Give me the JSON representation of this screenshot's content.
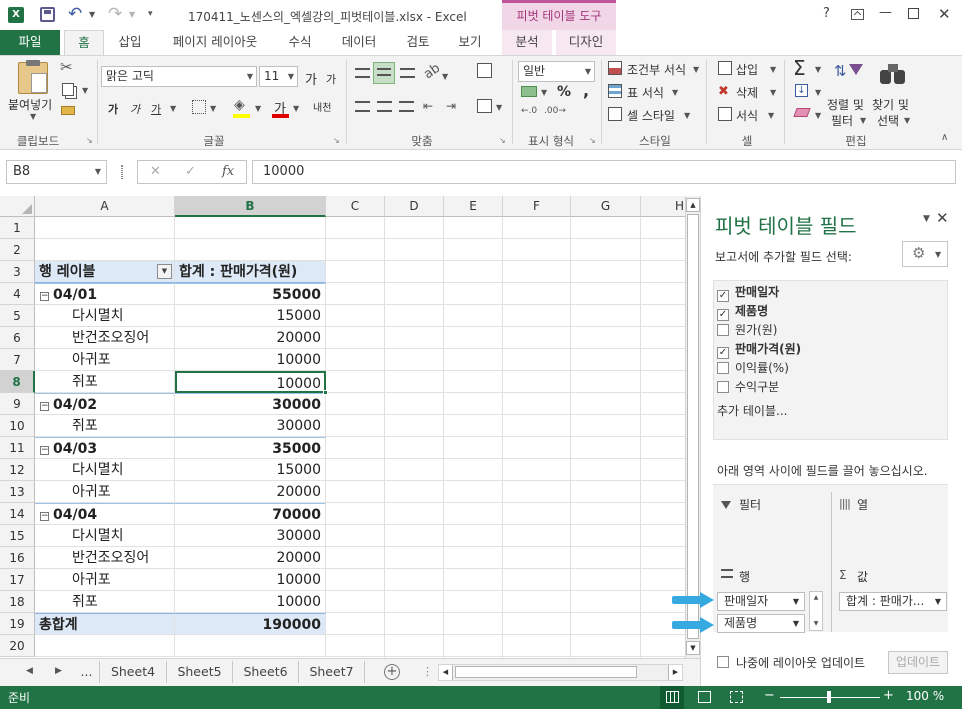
{
  "title": {
    "filename": "170411_노센스의_엑셀강의_피벗테이블.xlsx - Excel",
    "context_tab": "피벗 테이블 도구",
    "help": "?",
    "minimize": "—",
    "close": "✕"
  },
  "tabs": {
    "file": "파일",
    "home": "홈",
    "insert": "삽입",
    "page_layout": "페이지 레이아웃",
    "formulas": "수식",
    "data": "데이터",
    "review": "검토",
    "view": "보기",
    "analyze": "분석",
    "design": "디자인"
  },
  "ribbon": {
    "paste": "붙여넣기",
    "clipboard": "클립보드",
    "font_name": "맑은 고딕",
    "font_size": "11",
    "bold": "가",
    "italic": "가",
    "underline": "가",
    "font_color": "가",
    "grow_font": "가",
    "shrink_font": "가",
    "phonetic": "내천",
    "font_group": "글꼴",
    "align_group": "맞춤",
    "number_format": "일반",
    "percent": "%",
    "comma": ",",
    "number_group": "표시 형식",
    "cond_format": "조건부 서식",
    "table_format": "표 서식",
    "cell_style": "셀 스타일",
    "style_group": "스타일",
    "insert": "삽입",
    "delete": "삭제",
    "format": "서식",
    "cells_group": "셀",
    "sort_filter_1": "정렬 및",
    "sort_filter_2": "필터",
    "find_select_1": "찾기 및",
    "find_select_2": "선택",
    "editing_group": "편집",
    "sigma": "Σ"
  },
  "formula_bar": {
    "name_box": "B8",
    "cancel": "✕",
    "enter": "✓",
    "fx": "fx",
    "value": "10000"
  },
  "columns": [
    "A",
    "B",
    "C",
    "D",
    "E",
    "F",
    "G",
    "H"
  ],
  "rows": [
    {
      "n": "1",
      "a": "",
      "b": ""
    },
    {
      "n": "2",
      "a": "",
      "b": ""
    },
    {
      "n": "3",
      "a": "행 레이블",
      "b": "합계 : 판매가격(원)"
    },
    {
      "n": "4",
      "a": "04/01",
      "b": "55000"
    },
    {
      "n": "5",
      "a": "다시멸치",
      "b": "15000"
    },
    {
      "n": "6",
      "a": "반건조오징어",
      "b": "20000"
    },
    {
      "n": "7",
      "a": "아귀포",
      "b": "10000"
    },
    {
      "n": "8",
      "a": "쥐포",
      "b": "10000"
    },
    {
      "n": "9",
      "a": "04/02",
      "b": "30000"
    },
    {
      "n": "10",
      "a": "쥐포",
      "b": "30000"
    },
    {
      "n": "11",
      "a": "04/03",
      "b": "35000"
    },
    {
      "n": "12",
      "a": "다시멸치",
      "b": "15000"
    },
    {
      "n": "13",
      "a": "아귀포",
      "b": "20000"
    },
    {
      "n": "14",
      "a": "04/04",
      "b": "70000"
    },
    {
      "n": "15",
      "a": "다시멸치",
      "b": "30000"
    },
    {
      "n": "16",
      "a": "반건조오징어",
      "b": "20000"
    },
    {
      "n": "17",
      "a": "아귀포",
      "b": "10000"
    },
    {
      "n": "18",
      "a": "쥐포",
      "b": "10000"
    },
    {
      "n": "19",
      "a": "총합계",
      "b": "190000"
    },
    {
      "n": "20",
      "a": "",
      "b": ""
    }
  ],
  "sheets": {
    "ellipsis": "...",
    "s4": "Sheet4",
    "s5": "Sheet5",
    "s6": "Sheet6",
    "s7": "Sheet7",
    "add": "+"
  },
  "status": {
    "ready": "준비",
    "zoom_minus": "−",
    "zoom_plus": "+",
    "zoom": "100 %"
  },
  "pane": {
    "title": "피벗 테이블 필드",
    "subtitle": "보고서에 추가할 필드 선택:",
    "fields": [
      {
        "label": "판매일자",
        "checked": "✓"
      },
      {
        "label": "제품명",
        "checked": "✓"
      },
      {
        "label": "원가(원)",
        "checked": ""
      },
      {
        "label": "판매가격(원)",
        "checked": "✓"
      },
      {
        "label": "이익률(%)",
        "checked": ""
      },
      {
        "label": "수익구분",
        "checked": ""
      }
    ],
    "more_tables": "추가 테이블...",
    "drag_hint": "아래 영역 사이에 필드를 끌어 놓으십시오.",
    "filter": "필터",
    "columns": "열",
    "rows": "행",
    "values": "값",
    "row_item_1": "판매일자",
    "row_item_2": "제품명",
    "value_item": "합계 : 판매가...",
    "defer": "나중에 레이아웃 업데이트",
    "update": "업데이트"
  },
  "colors": {
    "excel_green": "#217346",
    "pivot_header": "#dde9f6",
    "arrow_blue": "#36a9e1",
    "context_pink": "#f0d6e6"
  }
}
